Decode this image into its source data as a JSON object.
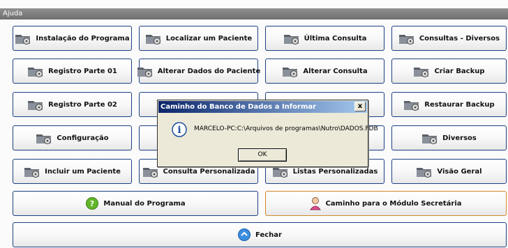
{
  "window": {
    "title": "Ajuda"
  },
  "buttons": {
    "instalacao": "Instalação do Programa",
    "localizar": "Localizar um Paciente",
    "ultima": "Última Consulta",
    "consultas_diversos": "Consultas - Diversos",
    "registro1": "Registro Parte 01",
    "alterar_paciente": "Alterar Dados do Paciente",
    "alterar_consulta": "Alterar Consulta",
    "criar_backup": "Criar Backup",
    "registro2": "Registro Parte 02",
    "restaurar_backup": "Restaurar Backup",
    "configuracao": "Configuração",
    "diversos": "Diversos",
    "incluir": "Incluir um Paciente",
    "consulta_personalizada": "Consulta Personalizada",
    "listas": "Listas Personalizadas",
    "visao_geral": "Visão Geral",
    "manual": "Manual do Programa",
    "caminho_secretaria": "Caminho para o Módulo Secretária",
    "fechar": "Fechar"
  },
  "dialog": {
    "title": "Caminho do Banco de Dados a Informar",
    "message": "MARCELO-PC:C:\\Arquivos de programas\\Nutro\\DADOS.FDB",
    "ok_label": "OK",
    "close_label": "x"
  },
  "colors": {
    "button_border": "#1b3f82",
    "accent_orange": "#d2872a",
    "dialog_title": "#0a246a"
  }
}
